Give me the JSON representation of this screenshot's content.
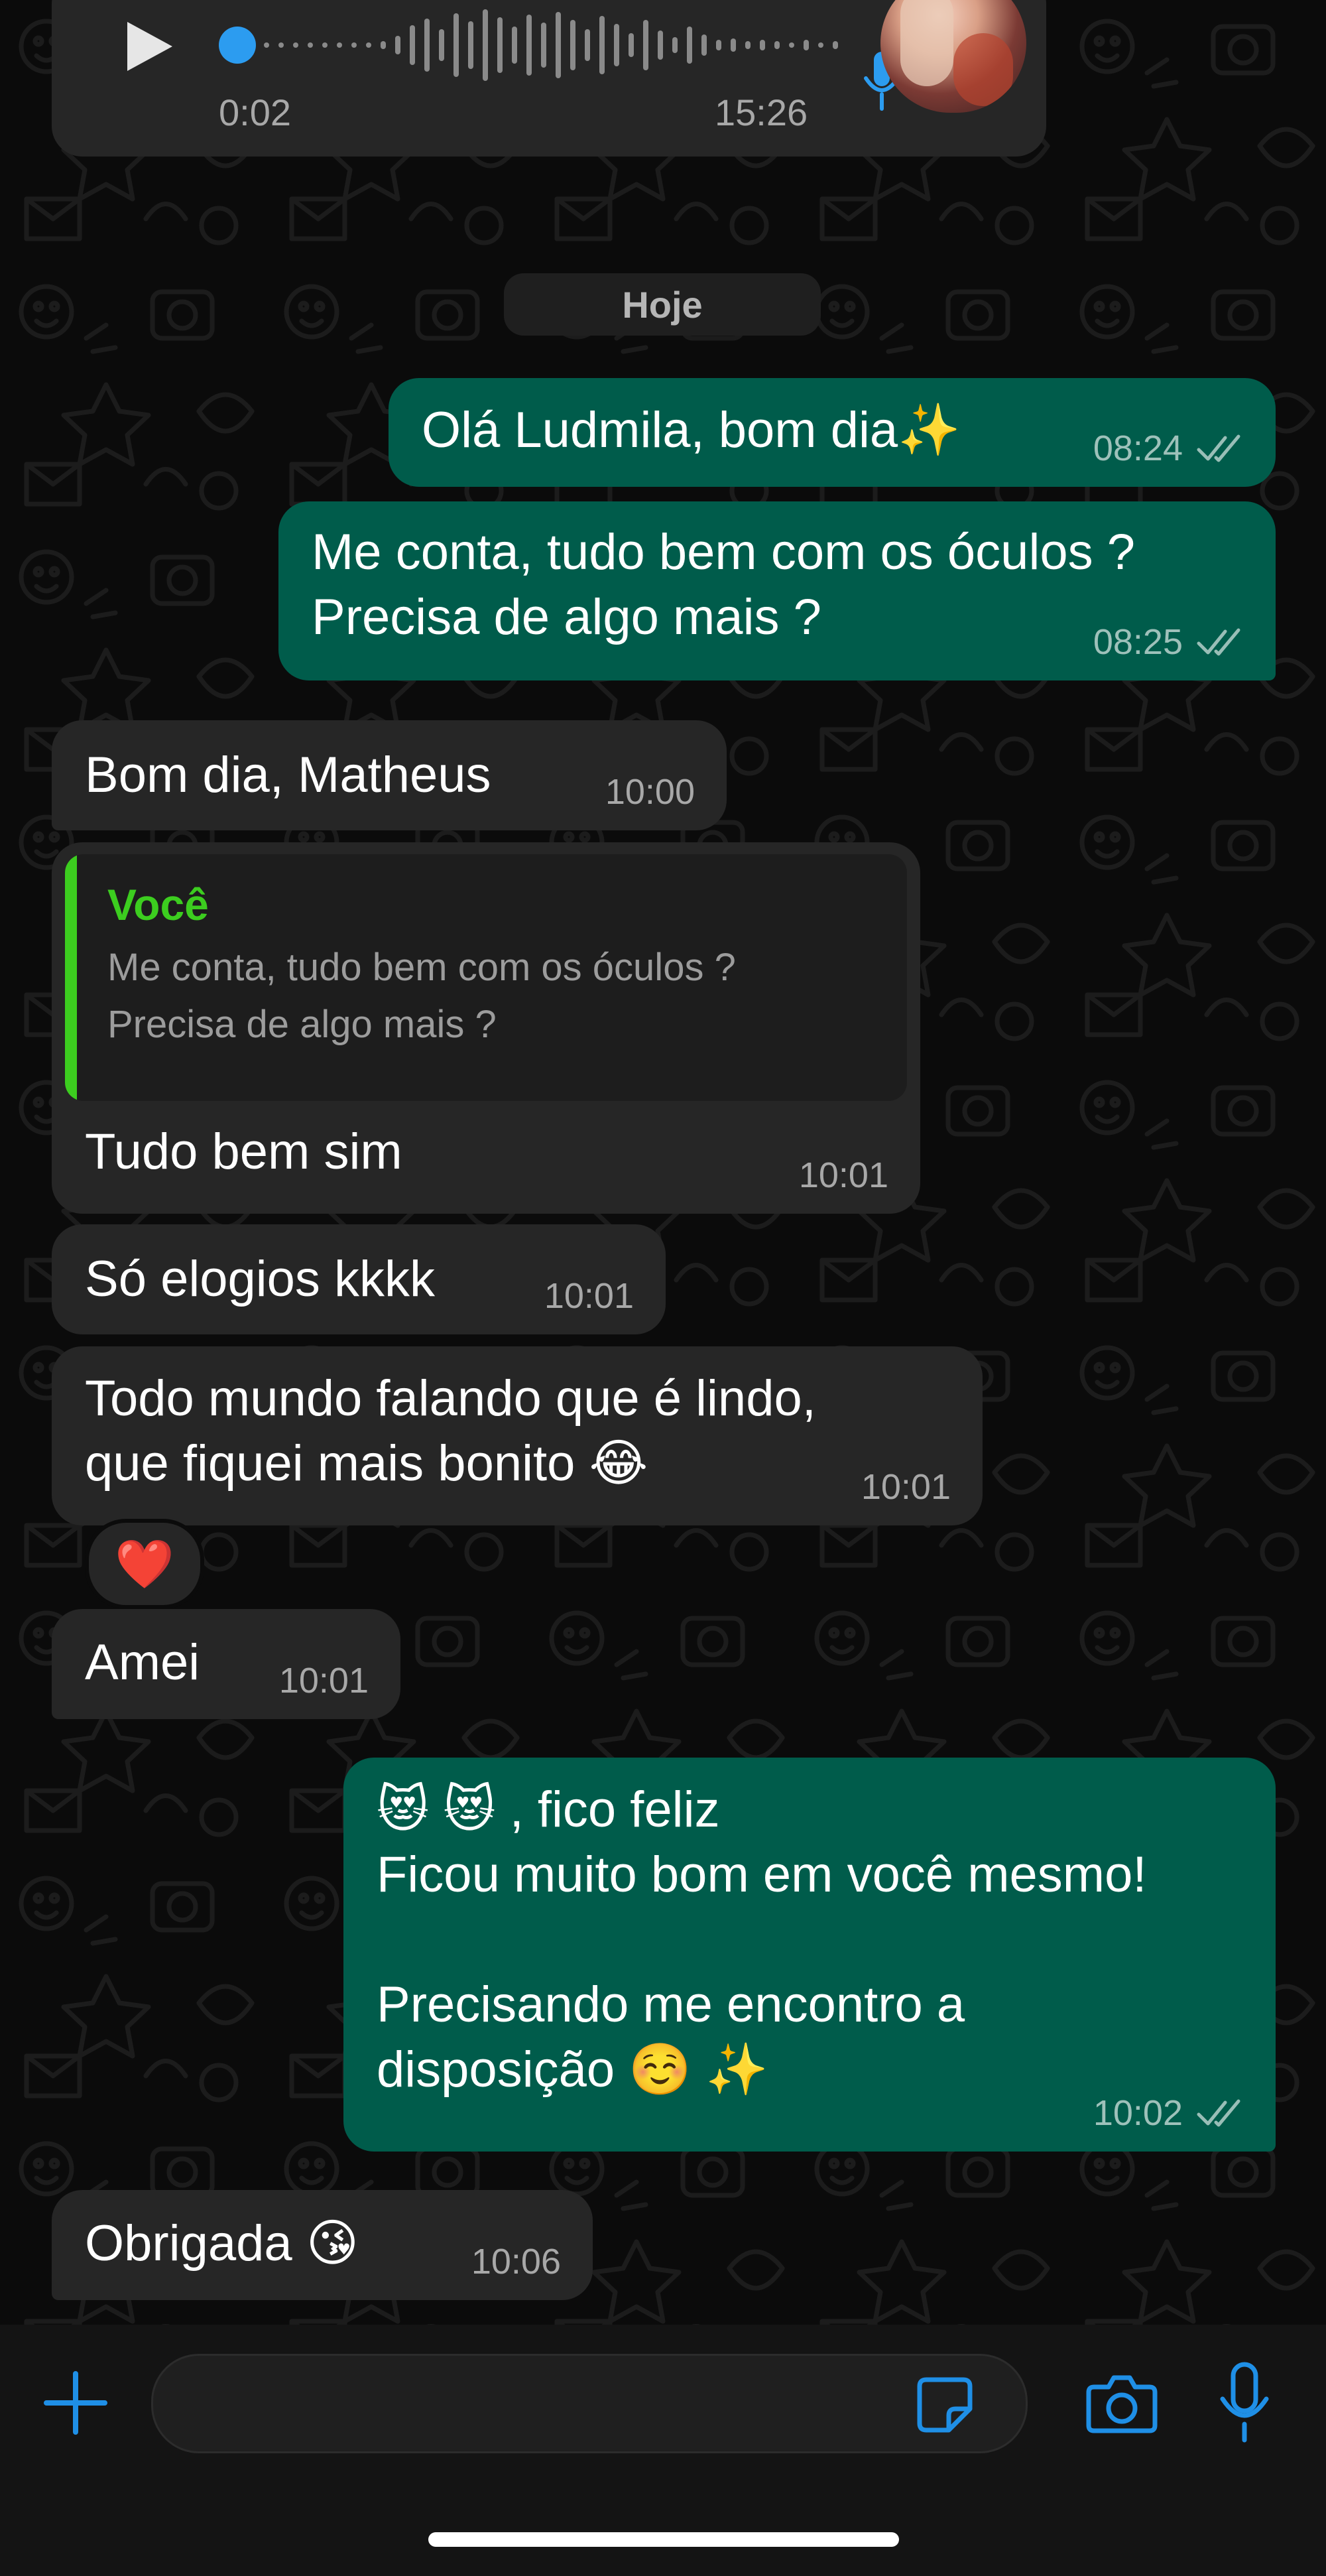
{
  "voice_message": {
    "elapsed": "0:02",
    "time": "15:26"
  },
  "date_separator": "Hoje",
  "messages": [
    {
      "text": "Olá Ludmila, bom dia✨",
      "time": "08:24"
    },
    {
      "text": "Me conta, tudo bem com os óculos ?\nPrecisa de algo mais ?",
      "time": "08:25"
    },
    {
      "text": "Bom dia, Matheus",
      "time": "10:00"
    },
    {
      "text": "Tudo bem sim",
      "time": "10:01",
      "quote_author": "Você",
      "quote_text": "Me conta, tudo bem com os óculos ?\nPrecisa de algo mais ?"
    },
    {
      "text": "Só elogios kkkk",
      "time": "10:01"
    },
    {
      "text": "Todo mundo falando que é lindo,\nque fiquei mais bonito 😂",
      "time": "10:01",
      "reaction": "❤️"
    },
    {
      "text": "Amei",
      "time": "10:01"
    },
    {
      "text": "😻 😻 , fico feliz\nFicou muito bom em você mesmo!\n\nPrecisando me encontro a\ndisposição ☺️ ✨",
      "time": "10:02"
    },
    {
      "text": "Obrigada 😘",
      "time": "10:06"
    }
  ],
  "colors": {
    "outgoing_bubble": "#005c4b",
    "incoming_bubble": "#262626",
    "accent_blue": "#1f8fe6",
    "quote_green": "#3ccd1f"
  },
  "composer": {
    "icons": [
      "plus-icon",
      "sticker-icon",
      "camera-icon",
      "microphone-icon"
    ]
  }
}
